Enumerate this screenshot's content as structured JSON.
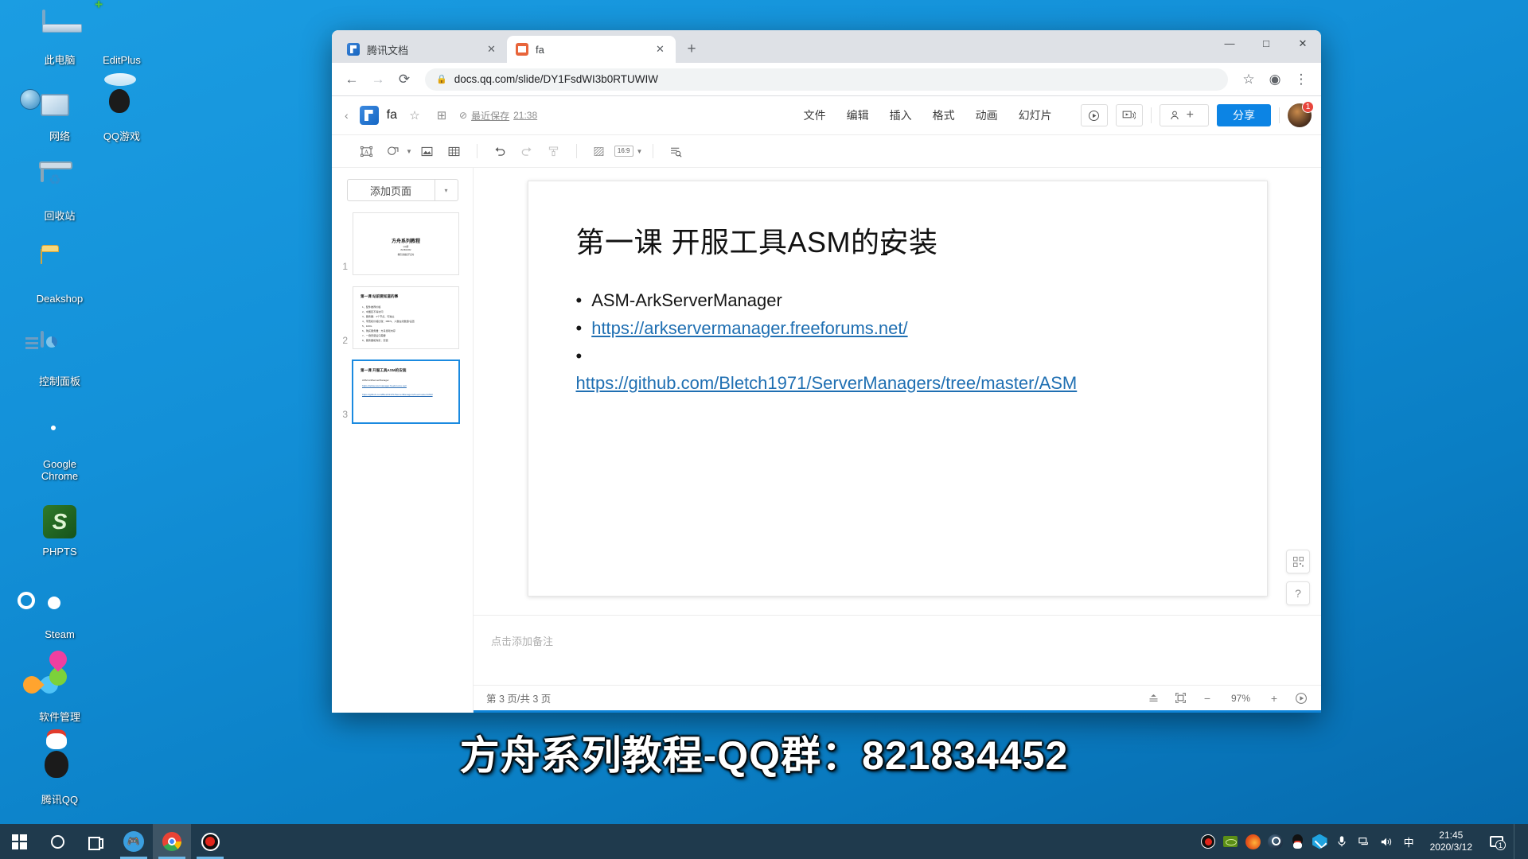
{
  "desktop": {
    "icons": [
      {
        "label": "此电脑",
        "icon": "this-pc-icon"
      },
      {
        "label": "EditPlus",
        "icon": "editplus-icon"
      },
      {
        "label": "网络",
        "icon": "network-icon"
      },
      {
        "label": "QQ游戏",
        "icon": "qq-game-icon"
      },
      {
        "label": "回收站",
        "icon": "recycle-bin-icon"
      },
      {
        "label": "Deakshop",
        "icon": "folder-icon"
      },
      {
        "label": "控制面板",
        "icon": "control-panel-icon"
      },
      {
        "label": "Google Chrome",
        "icon": "chrome-icon"
      },
      {
        "label": "PHPTS",
        "icon": "phpts-icon"
      },
      {
        "label": "Steam",
        "icon": "steam-icon"
      },
      {
        "label": "软件管理",
        "icon": "software-manager-icon"
      },
      {
        "label": "腾讯QQ",
        "icon": "tencent-qq-icon"
      }
    ]
  },
  "browser": {
    "tabs": [
      {
        "title": "腾讯文档",
        "active": false,
        "favicon": "tencent-docs-favicon"
      },
      {
        "title": "fa",
        "active": true,
        "favicon": "slide-favicon"
      }
    ],
    "new_tab_label": "+",
    "window_controls": {
      "minimize": "—",
      "maximize": "□",
      "close": "✕"
    },
    "nav": {
      "back": "←",
      "forward": "→",
      "reload": "⟳"
    },
    "address": {
      "lock_icon": "lock-icon",
      "host": "docs.qq.com",
      "path": "/slide/DY1FsdWI3b0RTUWIW",
      "full": "docs.qq.com/slide/DY1FsdWI3b0RTUWIW",
      "star_icon": "bookmark-star-icon",
      "profile_icon": "profile-icon",
      "menu_icon": "kebab-menu-icon"
    }
  },
  "docs": {
    "back_label": "‹",
    "logo": "tencent-docs-logo",
    "title": "fa",
    "star_icon": "☆",
    "move_icon": "⊞",
    "save_status": {
      "check_icon": "⊘",
      "text": "最近保存",
      "time": "21:38"
    },
    "menus": [
      "文件",
      "编辑",
      "插入",
      "格式",
      "动画",
      "幻灯片"
    ],
    "header_actions": {
      "present_icon": "play-present-icon",
      "broadcast_icon": "broadcast-present-icon",
      "invite_label": "",
      "share_label": "分享",
      "avatar_badge": "1"
    },
    "toolbar": {
      "items": [
        {
          "name": "text-box-icon",
          "glyph": "A"
        },
        {
          "name": "shape-icon",
          "glyph": "◯"
        },
        {
          "name": "image-icon",
          "glyph": "▣"
        },
        {
          "name": "table-icon",
          "glyph": "▦"
        },
        {
          "name": "undo-icon",
          "glyph": "↺"
        },
        {
          "name": "redo-icon",
          "glyph": "↻"
        },
        {
          "name": "format-painter-icon",
          "glyph": "⌶"
        },
        {
          "name": "background-fill-icon",
          "glyph": "▨"
        },
        {
          "name": "aspect-ratio-dropdown",
          "glyph": "16:9"
        },
        {
          "name": "find-replace-icon",
          "glyph": "⌕"
        }
      ]
    },
    "slide_panel": {
      "add_page_label": "添加页面",
      "add_page_caret": "▾",
      "thumbnails": [
        {
          "num": "1",
          "title": "方舟系列教程",
          "lines": [
            "QQ群",
            "821834452",
            "教程录播会不定时"
          ],
          "centered": true,
          "selected": false
        },
        {
          "num": "2",
          "title": "第一课 站前要知道的事",
          "lines": [
            "1、配件推荐价格",
            "2、中国区不得访问",
            "3、服务器：4个节点、可独立",
            "4、带宽和价格比较：MB/S、人数在线数量/设置",
            "5、100G",
            "6、购买服务器：方舟游戏内存",
            "7、一键安装后只需要",
            "8、服务器和购买：安装"
          ],
          "centered": false,
          "selected": false
        },
        {
          "num": "3",
          "title": "第一课 开服工具ASM的安装",
          "lines": [
            "ASM-ArkServerManager",
            "https://arkservermanager.freeforums.net/",
            "https://github.com/Bletch1971/ServerManagers/tree/master/ASM"
          ],
          "centered": false,
          "selected": true
        }
      ]
    },
    "slide": {
      "title": "第一课 开服工具ASM的安装",
      "bullets": [
        {
          "bullet": "•",
          "text": "ASM-ArkServerManager",
          "link": false
        },
        {
          "bullet": "•",
          "text": "https://arkservermanager.freeforums.net/",
          "link": true
        },
        {
          "bullet": "•",
          "text": "https://github.com/Bletch1971/ServerManagers/tree/master/ASM",
          "link": true
        }
      ]
    },
    "fabs": [
      {
        "name": "qr-code-icon",
        "glyph": "▩"
      },
      {
        "name": "help-icon",
        "glyph": "?"
      }
    ],
    "notes_placeholder": "点击添加备注",
    "status": {
      "page_info": "第 3 页/共 3 页",
      "notes_toggle_icon": "notes-toggle-icon",
      "fit_screen_icon": "fit-screen-icon",
      "zoom_out": "−",
      "zoom_level": "97%",
      "zoom_in": "+",
      "play_icon": "play-icon"
    }
  },
  "subtitle": "方舟系列教程-QQ群：821834452",
  "taskbar": {
    "start_icon": "windows-start-icon",
    "search_icon": "cortana-search-icon",
    "taskview_icon": "task-view-icon",
    "apps": [
      {
        "name": "qq-game-taskbar",
        "running": true,
        "active": false
      },
      {
        "name": "chrome-taskbar",
        "running": true,
        "active": true
      },
      {
        "name": "screen-recorder-taskbar",
        "running": true,
        "active": false
      }
    ],
    "tray": [
      {
        "name": "screen-recorder-tray-icon"
      },
      {
        "name": "nvidia-tray-icon"
      },
      {
        "name": "firefox-tray-icon"
      },
      {
        "name": "steam-tray-icon"
      },
      {
        "name": "qq-tray-icon"
      },
      {
        "name": "tencent-pc-manager-tray-icon"
      },
      {
        "name": "microphone-tray-icon"
      },
      {
        "name": "network-tray-icon"
      },
      {
        "name": "volume-tray-icon"
      },
      {
        "name": "ime-tray-icon",
        "glyph": "中"
      }
    ],
    "clock": {
      "time": "21:45",
      "date": "2020/3/12"
    },
    "notification_count": "1"
  },
  "colors": {
    "accent": "#0c84e4",
    "desktop": "#1390d8",
    "taskbar": "#1f3a4d",
    "link": "#1f6fb2",
    "record_red": "#e1251b"
  }
}
